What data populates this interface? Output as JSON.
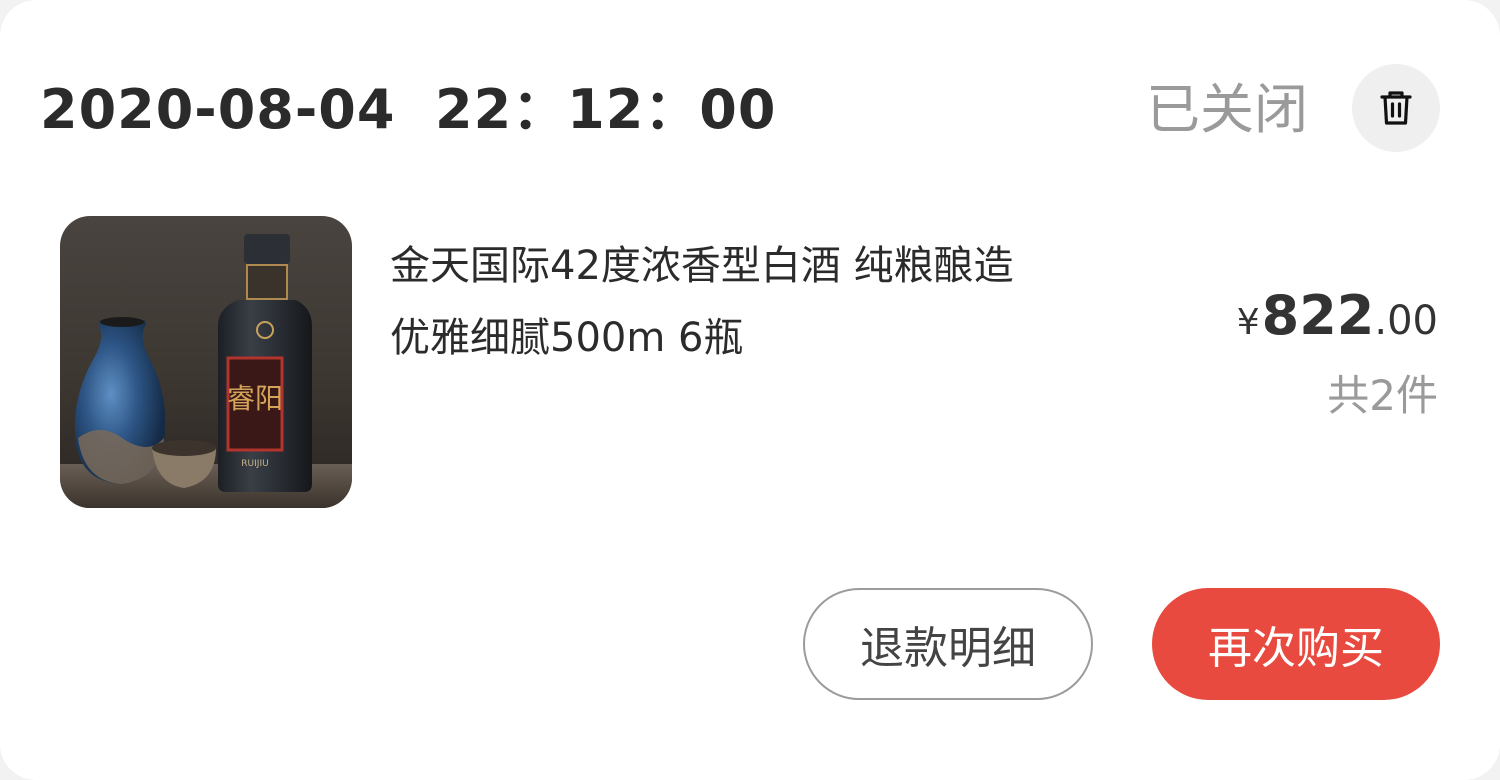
{
  "order": {
    "time": "2020-08-04  22：12：00",
    "status": "已关闭",
    "delete_icon": "trash-icon"
  },
  "product": {
    "title_line1": "金天国际42度浓香型白酒 纯粮酿造",
    "title_line2": "优雅细腻500m 6瓶",
    "price_currency": "¥",
    "price_integer": "822",
    "price_decimal": ".00",
    "quantity": "共2件",
    "image_label_text": "睿阳",
    "image_sub_label": "RUIJIU"
  },
  "actions": {
    "refund_label": "退款明细",
    "rebuy_label": "再次购买"
  },
  "colors": {
    "primary_red": "#e84a3f",
    "text_dark": "#2b2b2b",
    "text_gray": "#9a9a9a"
  }
}
